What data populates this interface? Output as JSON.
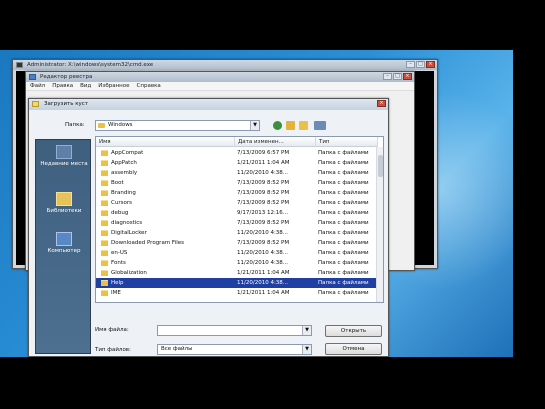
{
  "cmd_window": {
    "title": "Administrator: X:\\windows\\system32\\cmd.exe"
  },
  "regedit_window": {
    "title": "Редактор реестра",
    "menu": [
      "Файл",
      "Правка",
      "Вид",
      "Избранное",
      "Справка"
    ]
  },
  "dialog": {
    "title": "Загрузить куст",
    "lookin_label": "Папка:",
    "lookin_value": "Windows",
    "places": [
      {
        "label": "Недавние места",
        "icon": "recent-places-icon"
      },
      {
        "label": "Библиотеки",
        "icon": "libraries-icon"
      },
      {
        "label": "Компьютер",
        "icon": "computer-icon"
      }
    ],
    "columns": [
      "Имя",
      "Дата изменен...",
      "Тип"
    ],
    "rows": [
      {
        "name": "AppCompat",
        "date": "7/13/2009 6:57 PM",
        "type": "Папка с файлами"
      },
      {
        "name": "AppPatch",
        "date": "1/21/2011 1:04 AM",
        "type": "Папка с файлами"
      },
      {
        "name": "assembly",
        "date": "11/20/2010 4:38...",
        "type": "Папка с файлами"
      },
      {
        "name": "Boot",
        "date": "7/13/2009 8:52 PM",
        "type": "Папка с файлами"
      },
      {
        "name": "Branding",
        "date": "7/13/2009 8:52 PM",
        "type": "Папка с файлами"
      },
      {
        "name": "Cursors",
        "date": "7/13/2009 8:52 PM",
        "type": "Папка с файлами"
      },
      {
        "name": "debug",
        "date": "9/17/2013 12:16...",
        "type": "Папка с файлами"
      },
      {
        "name": "diagnostics",
        "date": "7/13/2009 8:52 PM",
        "type": "Папка с файлами"
      },
      {
        "name": "DigitalLocker",
        "date": "11/20/2010 4:38...",
        "type": "Папка с файлами"
      },
      {
        "name": "Downloaded Program Files",
        "date": "7/13/2009 8:52 PM",
        "type": "Папка с файлами"
      },
      {
        "name": "en-US",
        "date": "11/20/2010 4:38...",
        "type": "Папка с файлами"
      },
      {
        "name": "Fonts",
        "date": "11/20/2010 4:38...",
        "type": "Папка с файлами"
      },
      {
        "name": "Globalization",
        "date": "1/21/2011 1:04 AM",
        "type": "Папка с файлами"
      },
      {
        "name": "Help",
        "date": "11/20/2010 4:38...",
        "type": "Папка с файлами",
        "selected": true
      },
      {
        "name": "IME",
        "date": "1/21/2011 1:04 AM",
        "type": "Папка с файлами"
      }
    ],
    "filename_label": "Имя файла:",
    "filename_value": "",
    "filetype_label": "Тип файлов:",
    "filetype_value": "Все файлы",
    "open_label": "Открыть",
    "cancel_label": "Отмена"
  }
}
